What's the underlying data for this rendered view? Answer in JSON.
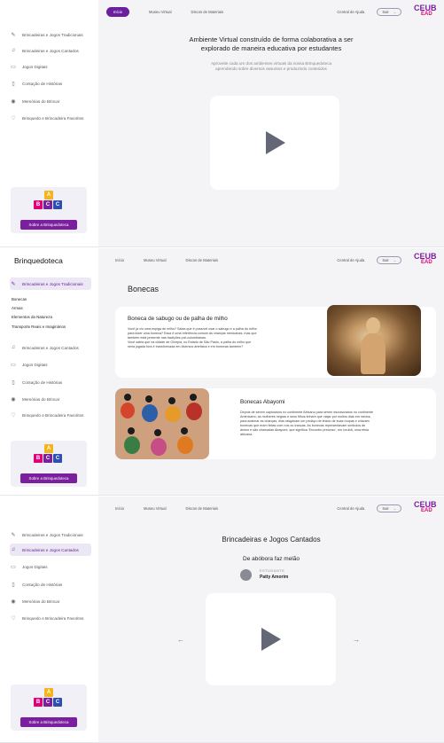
{
  "colors": {
    "accent": "#6a1f9d",
    "brand_pink": "#e2007a",
    "play": "#646876"
  },
  "topnav": {
    "inicio": "Início",
    "museu": "Museu Virtual",
    "discos": "Discos de Materiais",
    "help": "Central de Ajuda",
    "exit": "Sair"
  },
  "topnav_lower": {
    "inicio": "Início"
  },
  "logo": {
    "main": "CEUB",
    "sub": "EAD"
  },
  "sidebar": {
    "brand": "Brinquedoteca",
    "items": [
      {
        "label": "Brincadeiras e Jogos Tradicionais",
        "icon": "pencil-icon"
      },
      {
        "label": "Brincadeiras e Jogos Cantados",
        "icon": "music-note-icon"
      },
      {
        "label": "Jogos Digitais",
        "icon": "gamepad-icon"
      },
      {
        "label": "Contação de Histórias",
        "icon": "book-icon"
      },
      {
        "label": "Memórias do Brincar",
        "icon": "location-pin-icon"
      },
      {
        "label": "Brinquedo e Brincadeira Favoritos",
        "icon": "heart-icon"
      }
    ],
    "subitems": [
      "Bonecas",
      "Armas",
      "Elementos da Natureza",
      "Transporte Reais e Imaginários"
    ],
    "promo_button": "Sobre a Brinquedoteca",
    "blocks": [
      "A",
      "B",
      "C",
      "C"
    ]
  },
  "screen1": {
    "title_line1": "Ambiente Virtual construído de forma colaborativa a ser",
    "title_line2": "explorado de maneira educativa por estudantes",
    "sub_line1": "Aproveite cada um dos ambientes virtuais da nossa Brinquedoteca",
    "sub_line2": "aprendendo sobre diversos assuntos e produzindo conteúdos"
  },
  "screen2": {
    "page_title": "Bonecas",
    "card1": {
      "title": "Boneca de sabugo ou de palha de milho",
      "text": [
        "Você já viu uma espiga de milho? Sabia que é possível usar o sabugo e a palha do milho",
        "para fazer uma boneca? Essa é uma referência comum às crianças mexicanas, mas que",
        "também está presente nas tradições pré-colombianas.",
        "Você sabia que na cidade de Olímpia, no Estado de São Paulo, a palha do milho que",
        "seria jogada fora é transformada em diversos artefatos e em bonecas também?"
      ]
    },
    "card2": {
      "title": "Bonecas Abayomi",
      "text": [
        "Depois de serem capturados no continente Africano para serem escravizados no continente",
        "Americano, as mulheres negras e seus filhos tinham que viajar por muitos dias em navios,",
        "para acalmar as crianças, elas rasgavam um pedaço de tecido de suas roupas e criavam",
        "bonecas que eram feitas com nós ou tranças. As bonecas representavam símbolos de",
        "ânimo e são chamadas Abayomi, que significa 'Encontro precioso', em Iorubá, uma etnia",
        "africana."
      ]
    }
  },
  "screen3": {
    "page_title": "Brincadeiras e Jogos Cantados",
    "song_title": "De abóbora faz melão",
    "student_label": "ESTUDANTE",
    "student_name": "Patty Amorim",
    "prev": "←",
    "next": "→"
  }
}
